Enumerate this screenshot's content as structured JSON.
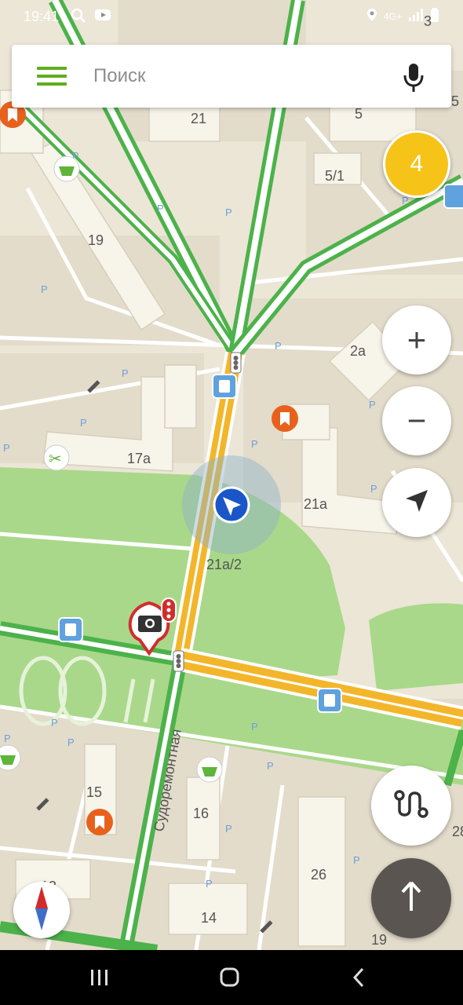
{
  "status_bar": {
    "time": "19:41",
    "network": "4G+"
  },
  "search": {
    "placeholder": "Поиск"
  },
  "traffic": {
    "level": "4",
    "color": "#f6c418"
  },
  "map": {
    "street_name": "Судоремонтная",
    "house_numbers": [
      "21",
      "5",
      "5/1",
      "19",
      "2а",
      "17а",
      "21а",
      "21а/2",
      "15",
      "16",
      "26",
      "14",
      "13",
      "19",
      "28",
      "3"
    ],
    "accent_colors": {
      "road_green": "#4cb24a",
      "road_yellow": "#f3b62b",
      "park": "#a9d88a",
      "location": "#1a56c8"
    }
  },
  "controls": {
    "zoom_in": "+",
    "zoom_out": "−"
  },
  "icons": [
    "menu-icon",
    "mic-icon",
    "location-arrow-icon",
    "route-icon",
    "navigation-arrow-icon",
    "compass-icon",
    "bus-stop-icon",
    "parking-icon",
    "shop-icon",
    "bookmark-icon",
    "camera-icon",
    "traffic-light-icon",
    "haircut-icon",
    "gym-icon"
  ]
}
